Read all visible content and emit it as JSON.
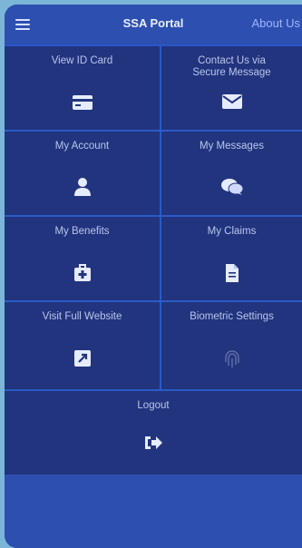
{
  "header": {
    "menu_icon": "hamburger-menu-icon",
    "title": "SSA Portal",
    "about_label": "About Us"
  },
  "tiles": [
    {
      "label": "View ID Card",
      "icon": "id-card-icon"
    },
    {
      "label": "Contact Us via\nSecure Message",
      "icon": "envelope-icon"
    },
    {
      "label": "My Account",
      "icon": "user-icon"
    },
    {
      "label": "My Messages",
      "icon": "chat-bubbles-icon"
    },
    {
      "label": "My Benefits",
      "icon": "medical-kit-icon"
    },
    {
      "label": "My Claims",
      "icon": "document-icon"
    },
    {
      "label": "Visit Full Website",
      "icon": "external-link-icon"
    },
    {
      "label": "Biometric Settings",
      "icon": "fingerprint-icon"
    }
  ],
  "logout": {
    "label": "Logout",
    "icon": "logout-icon"
  },
  "colors": {
    "background": "#1e2f6e",
    "tile": "#22347d",
    "header": "#2d4fb0",
    "grid_line": "#2a5bc9",
    "text": "#b9c6ee"
  }
}
